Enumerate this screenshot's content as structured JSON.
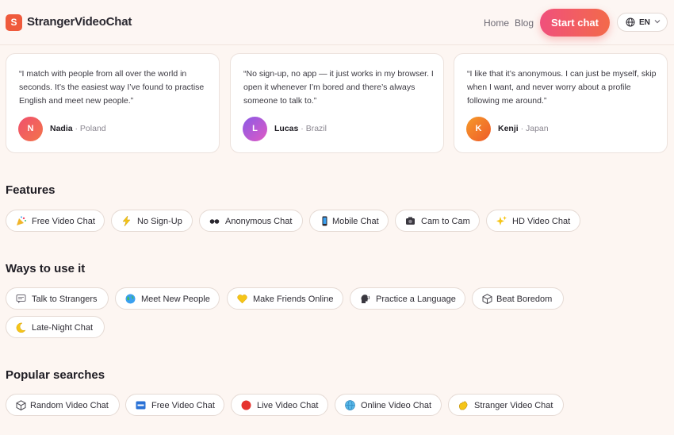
{
  "header": {
    "logo_letter": "S",
    "brand": "StrangerVideoChat",
    "nav": {
      "home": "Home",
      "blog": "Blog"
    },
    "cta": "Start chat",
    "language": "EN"
  },
  "testimonials": [
    {
      "quote": "“I match with people from all over the world in seconds. It’s the easiest way I’ve found to practise English and meet new people.”",
      "initial": "N",
      "name": "Nadia",
      "country": "· Poland",
      "avatar_color": "#f0506e"
    },
    {
      "quote": "“No sign-up, no app — it just works in my browser. I open it whenever I’m bored and there’s always someone to talk to.”",
      "initial": "L",
      "name": "Lucas",
      "country": "· Brazil",
      "avatar_color": "#b154e0"
    },
    {
      "quote": "“I like that it’s anonymous. I can just be myself, skip when I want, and never worry about a profile following me around.”",
      "initial": "K",
      "name": "Kenji",
      "country": "· Japan",
      "avatar_color": "#f37a2a"
    }
  ],
  "features": {
    "title": "Features",
    "chips": [
      {
        "label": "Free Video Chat",
        "icon": "party-popper-icon"
      },
      {
        "label": "No Sign-Up",
        "icon": "lightning-icon"
      },
      {
        "label": "Anonymous Chat",
        "icon": "disguise-glasses-icon"
      },
      {
        "label": "Mobile Chat",
        "icon": "mobile-phone-icon"
      },
      {
        "label": "Cam to Cam",
        "icon": "webcam-icon"
      },
      {
        "label": "HD Video Chat",
        "icon": "sparkles-icon"
      }
    ]
  },
  "ways": {
    "title": "Ways to use it",
    "chips": [
      {
        "label": "Talk to Strangers",
        "icon": "speech-bubble-icon"
      },
      {
        "label": "Meet New People",
        "icon": "globe-icon"
      },
      {
        "label": "Make Friends Online",
        "icon": "yellow-heart-icon"
      },
      {
        "label": "Practice a Language",
        "icon": "speaking-head-icon"
      },
      {
        "label": "Beat Boredom",
        "icon": "dice-icon"
      },
      {
        "label": "Late-Night Chat",
        "icon": "crescent-moon-icon"
      }
    ]
  },
  "popular": {
    "title": "Popular searches",
    "chips": [
      {
        "label": "Random Video Chat",
        "icon": "dice-icon"
      },
      {
        "label": "Free Video Chat",
        "icon": "free-badge-icon"
      },
      {
        "label": "Live Video Chat",
        "icon": "red-circle-icon"
      },
      {
        "label": "Online Video Chat",
        "icon": "globe-icon"
      },
      {
        "label": "Stranger Video Chat",
        "icon": "waving-hand-icon"
      }
    ]
  }
}
